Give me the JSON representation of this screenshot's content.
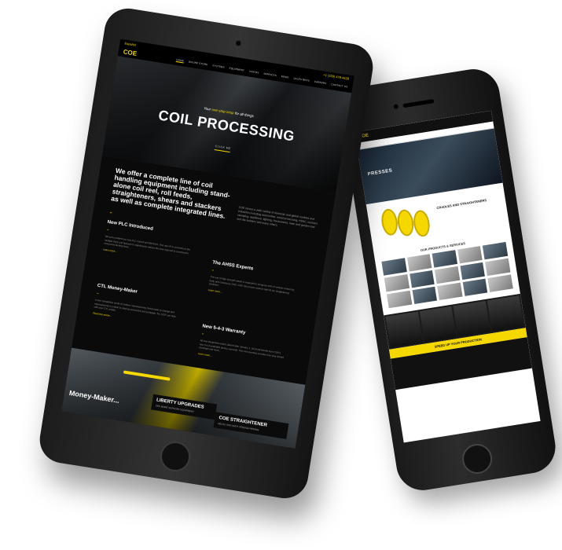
{
  "tablet": {
    "top_strip": {
      "language": "Español",
      "phone": "+1 (330) 479-4428"
    },
    "nav": {
      "logo": "COE",
      "items": [
        "HOME",
        "ONLINE STORE",
        "SYSTEMS",
        "EQUIPMENT",
        "VIDEOS",
        "SERVICES",
        "NEWS",
        "SALES REPS",
        "CAREERS",
        "CONTACT US"
      ]
    },
    "hero": {
      "tag_prefix": "Your",
      "tag_highlight": "one-stop shop",
      "tag_suffix": "for all things",
      "title": "COIL PROCESSING",
      "cta": "CLICK ME"
    },
    "intro": {
      "headline": "We offer a complete line of coil handling equipment including stand-alone coil reel, roll feeds, straighteners, shears and stackers as well as complete integrated lines.",
      "paragraph": "COE serves a wide variety of domestic and global markets and industries including automotive, metal processing, HVAC, contract stamping, appliance, lighting, housewares, lawn and garden tool and die builders and many others."
    },
    "news": [
      {
        "title": "New PLC Introduced",
        "text": "We just unveiled our new PLC control at FABTECH. This new PLC connects to the multiple drive unit features to significantly reduce the time required to commission new press feeding lines.",
        "more": "Learn more..."
      },
      {
        "title": "The AHSS Experts",
        "text": "The use of high strength steels is expected to comprise 40% of vehicle content by body and chassis by 2025. COE has proven science behind our straightening solutions.",
        "more": "Learn more..."
      },
      {
        "title": "CTL Money-Maker",
        "text": "In the competitive world of modern manufacturing, being open to change and improvements is critical to staying successful and profitable. No. COE can help with your CTL needs.",
        "more": "Read this article..."
      },
      {
        "title": "New 5-4-3 Warranty",
        "text": "All new equipment orders placed after January 1, 2019 will benefit from COE's new 5-4-3 extended factory warranty. This new warranty provides five-year limited coverage and more...",
        "more": "Learn more..."
      }
    ],
    "bottom_cards": [
      {
        "title": "LIBERTY UPGRADES",
        "subtitle": "SEE MORE SUPPORT EQUIPMENT"
      },
      {
        "title": "COE STRAIGHTENER",
        "subtitle": "HELPS SITE WITH STRENGTHENING"
      }
    ],
    "bottom_text": "Money-Maker..."
  },
  "phone": {
    "logo": "COE",
    "hero_label": "PRESSES",
    "product_title": "CRADLES AND STRAIGHTENERS",
    "products_heading": "OUR PRODUCTS & SERVICES",
    "banner": "SPEED UP YOUR PRODUCTION"
  },
  "colors": {
    "accent": "#f5d800",
    "background": "#0a0a0a",
    "device": "#1c1c1c"
  }
}
